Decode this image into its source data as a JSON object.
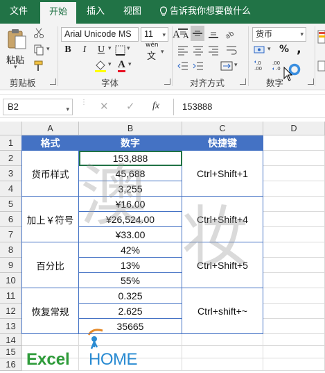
{
  "ribbon_tabs": {
    "file": "文件",
    "home": "开始",
    "insert": "插入",
    "view": "视图",
    "tell_me": "告诉我你想要做什么"
  },
  "clipboard": {
    "paste_label": "粘贴",
    "group_label": "剪贴板"
  },
  "font": {
    "font_name": "Arial Unicode MS",
    "font_size": "11",
    "bold": "B",
    "italic": "I",
    "underline": "U",
    "wen_label": "wén",
    "wen_char": "文",
    "increase_size": "A",
    "decrease_size": "A",
    "group_label": "字体",
    "font_color": "#e81123",
    "fill_color": "#ffff00"
  },
  "alignment": {
    "group_label": "对齐方式"
  },
  "number": {
    "format": "货币",
    "percent": "%",
    "comma": ",",
    "inc_decimal": ".0 .00",
    "dec_decimal": ".00 .0",
    "group_label": "数字"
  },
  "formula_bar": {
    "name_box": "B2",
    "fx": "fx",
    "cancel": "✕",
    "enter": "✓",
    "value": "153888"
  },
  "grid": {
    "columns": [
      "A",
      "B",
      "C",
      "D"
    ],
    "rows": [
      "1",
      "2",
      "3",
      "4",
      "5",
      "6",
      "7",
      "8",
      "9",
      "10",
      "11",
      "12",
      "13",
      "14",
      "15",
      "16"
    ],
    "header": {
      "format": "格式",
      "number": "数字",
      "shortcut": "快捷键"
    },
    "groups": [
      {
        "format": "货币样式",
        "numbers": [
          "153,888",
          "45,688",
          "3,255"
        ],
        "shortcut": "Ctrl+Shift+1"
      },
      {
        "format": "加上￥符号",
        "numbers": [
          "¥16.00",
          "¥26,524.00",
          "¥33.00"
        ],
        "shortcut": "Ctrl+Shift+4"
      },
      {
        "format": "百分比",
        "numbers": [
          "42%",
          "13%",
          "55%"
        ],
        "shortcut": "Ctrl+Shift+5"
      },
      {
        "format": "恢复常规",
        "numbers": [
          "0.325",
          "2.625",
          "35665"
        ],
        "shortcut": "Ctrl+shift+~"
      }
    ],
    "header_color": "#4472c4"
  },
  "watermark": {
    "chars": [
      "澳",
      "妆"
    ]
  },
  "logo": {
    "text_excel": "Excel",
    "text_home": "HOME",
    "brand_green": "#2e9b3a",
    "brand_blue": "#2a8bd2"
  },
  "colors": {
    "accent": "#217346"
  }
}
